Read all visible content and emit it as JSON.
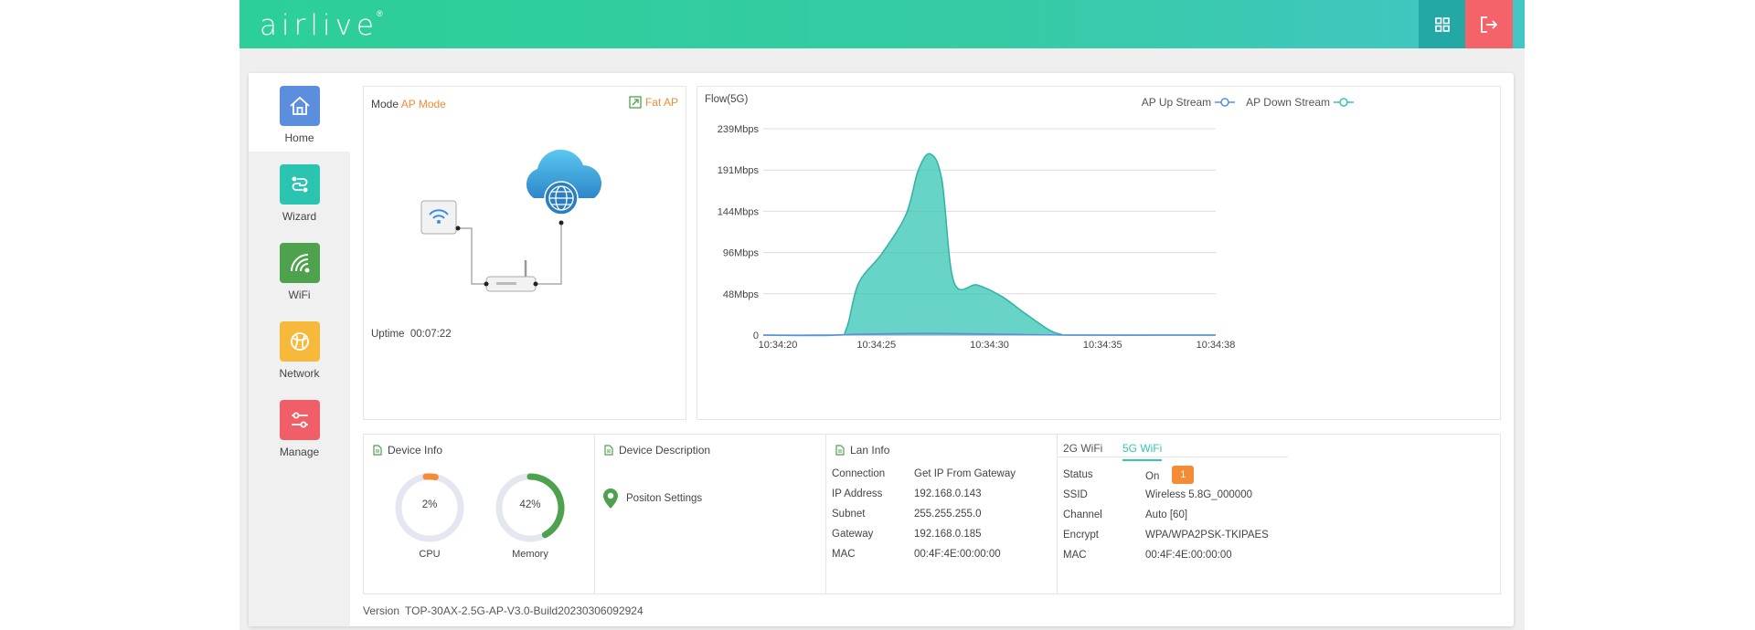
{
  "brand": {
    "logo_text": "airlive",
    "reg_mark": "®"
  },
  "header": {
    "apps_icon": "grid-icon",
    "logout_icon": "logout-icon"
  },
  "sidebar": {
    "items": [
      {
        "label": "Home",
        "icon": "home-icon",
        "color": "#5b8fde"
      },
      {
        "label": "Wizard",
        "icon": "link-icon",
        "color": "#2bc4b0"
      },
      {
        "label": "WiFi",
        "icon": "wifi-icon",
        "color": "#4ea24d"
      },
      {
        "label": "Network",
        "icon": "globe-icon",
        "color": "#f7b93b"
      },
      {
        "label": "Manage",
        "icon": "sliders-icon",
        "color": "#f05f68"
      }
    ]
  },
  "mode": {
    "label": "Mode",
    "value": "AP Mode",
    "switch_label": "Fat AP",
    "uptime_label": "Uptime",
    "uptime_value": "00:07:22"
  },
  "flow": {
    "title": "Flow(5G)",
    "legend": [
      {
        "name": "AP Up Stream",
        "color": "#5b8fde"
      },
      {
        "name": "AP Down Stream",
        "color": "#36c4b4"
      }
    ]
  },
  "chart_data": {
    "type": "area",
    "title": "Flow(5G)",
    "y_ticks": [
      "0",
      "48Mbps",
      "96Mbps",
      "144Mbps",
      "191Mbps",
      "239Mbps"
    ],
    "ylim": [
      0,
      239
    ],
    "x_ticks": [
      "10:34:20",
      "10:34:25",
      "10:34:30",
      "10:34:35",
      "10:34:38"
    ],
    "xlim": [
      0,
      19
    ],
    "grid": true,
    "legend_position": "top-right",
    "series": [
      {
        "name": "AP Up Stream",
        "color": "#5b8fde",
        "x": [
          0,
          3,
          4,
          7,
          10,
          13,
          19
        ],
        "values": [
          0,
          0,
          1,
          2,
          1,
          0,
          0
        ]
      },
      {
        "name": "AP Down Stream",
        "color": "#36c4b4",
        "x": [
          0,
          3,
          3.5,
          4,
          5,
          6,
          6.5,
          7,
          7.5,
          8,
          9,
          10,
          11,
          12,
          12.5,
          13,
          19
        ],
        "values": [
          0,
          0,
          8,
          60,
          95,
          140,
          190,
          210,
          180,
          62,
          58,
          45,
          25,
          6,
          1,
          0,
          0
        ]
      }
    ]
  },
  "device_info": {
    "title": "Device Info",
    "cpu_value": "2%",
    "cpu_label": "CPU",
    "cpu_percent": 2,
    "memory_value": "42%",
    "memory_label": "Memory",
    "memory_percent": 42
  },
  "device_description": {
    "title": "Device Description",
    "position_label": "Positon Settings"
  },
  "lan_info": {
    "title": "Lan Info",
    "rows": [
      {
        "key": "Connection",
        "value": "Get IP From Gateway"
      },
      {
        "key": "IP Address",
        "value": "192.168.0.143"
      },
      {
        "key": "Subnet",
        "value": "255.255.255.0"
      },
      {
        "key": "Gateway",
        "value": "192.168.0.185"
      },
      {
        "key": "MAC",
        "value": "00:4F:4E:00:00:00"
      }
    ]
  },
  "wifi_info": {
    "tabs": [
      "2G WiFi",
      "5G WiFi"
    ],
    "active_tab": "5G WiFi",
    "rows": [
      {
        "key": "Status",
        "value": "On"
      },
      {
        "key": "SSID",
        "value": "Wireless 5.8G_000000"
      },
      {
        "key": "Channel",
        "value": "Auto [60]"
      },
      {
        "key": "Encrypt",
        "value": "WPA/WPA2PSK-TKIPAES"
      },
      {
        "key": "MAC",
        "value": "00:4F:4E:00:00:00"
      }
    ],
    "status_badge": "1"
  },
  "footer": {
    "version_label": "Version",
    "version_value": "TOP-30AX-2.5G-AP-V3.0-Build20230306092924"
  }
}
